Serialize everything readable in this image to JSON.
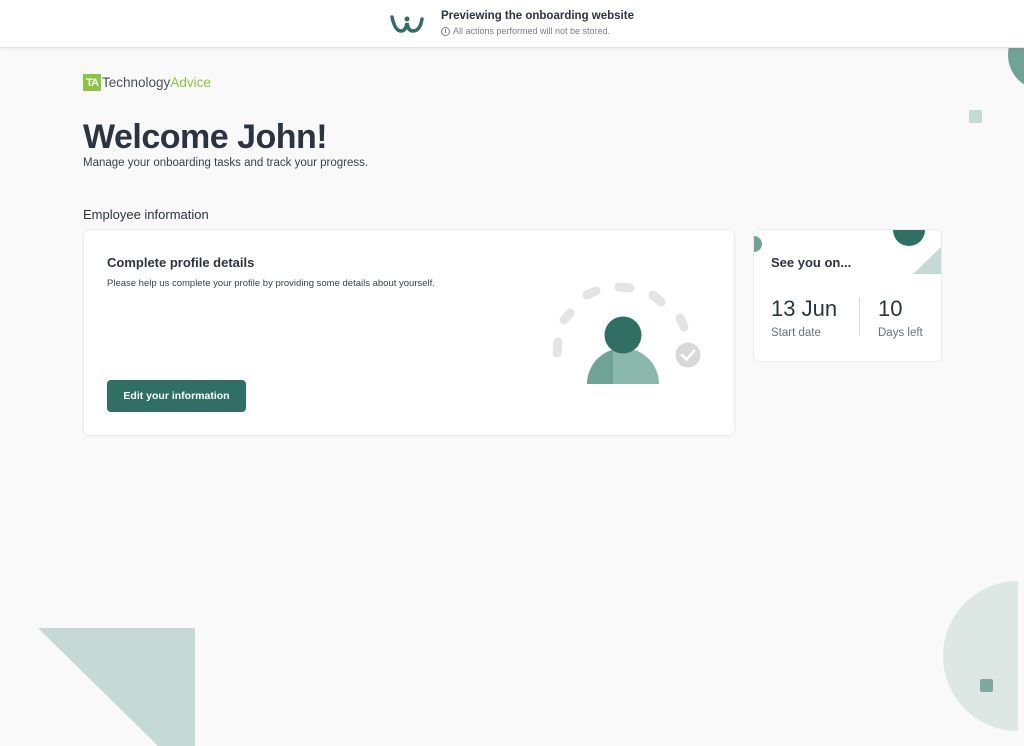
{
  "banner": {
    "title": "Previewing the onboarding website",
    "subtitle": "All actions performed will not be stored.",
    "logo_icon": "w-logo-icon",
    "info_icon": "info-icon"
  },
  "brand": {
    "mark": "TA",
    "name_part1": "Technology",
    "name_part2": "Advice",
    "accent_color": "#8cc63f"
  },
  "welcome": {
    "title": "Welcome John!",
    "subtitle": "Manage your onboarding tasks and track your progress."
  },
  "employee_section": {
    "heading": "Employee information",
    "card": {
      "title": "Complete profile details",
      "description": "Please help us complete your profile by providing some details about yourself.",
      "button_label": "Edit your information",
      "illustration_icon": "profile-progress-icon"
    }
  },
  "start_card": {
    "title": "See you on...",
    "start_date_value": "13 Jun",
    "start_date_label": "Start date",
    "days_left_value": "10",
    "days_left_label": "Days left"
  },
  "colors": {
    "primary": "#2f6f64",
    "light_teal": "#c6dad5",
    "background": "#f9f9f9"
  }
}
